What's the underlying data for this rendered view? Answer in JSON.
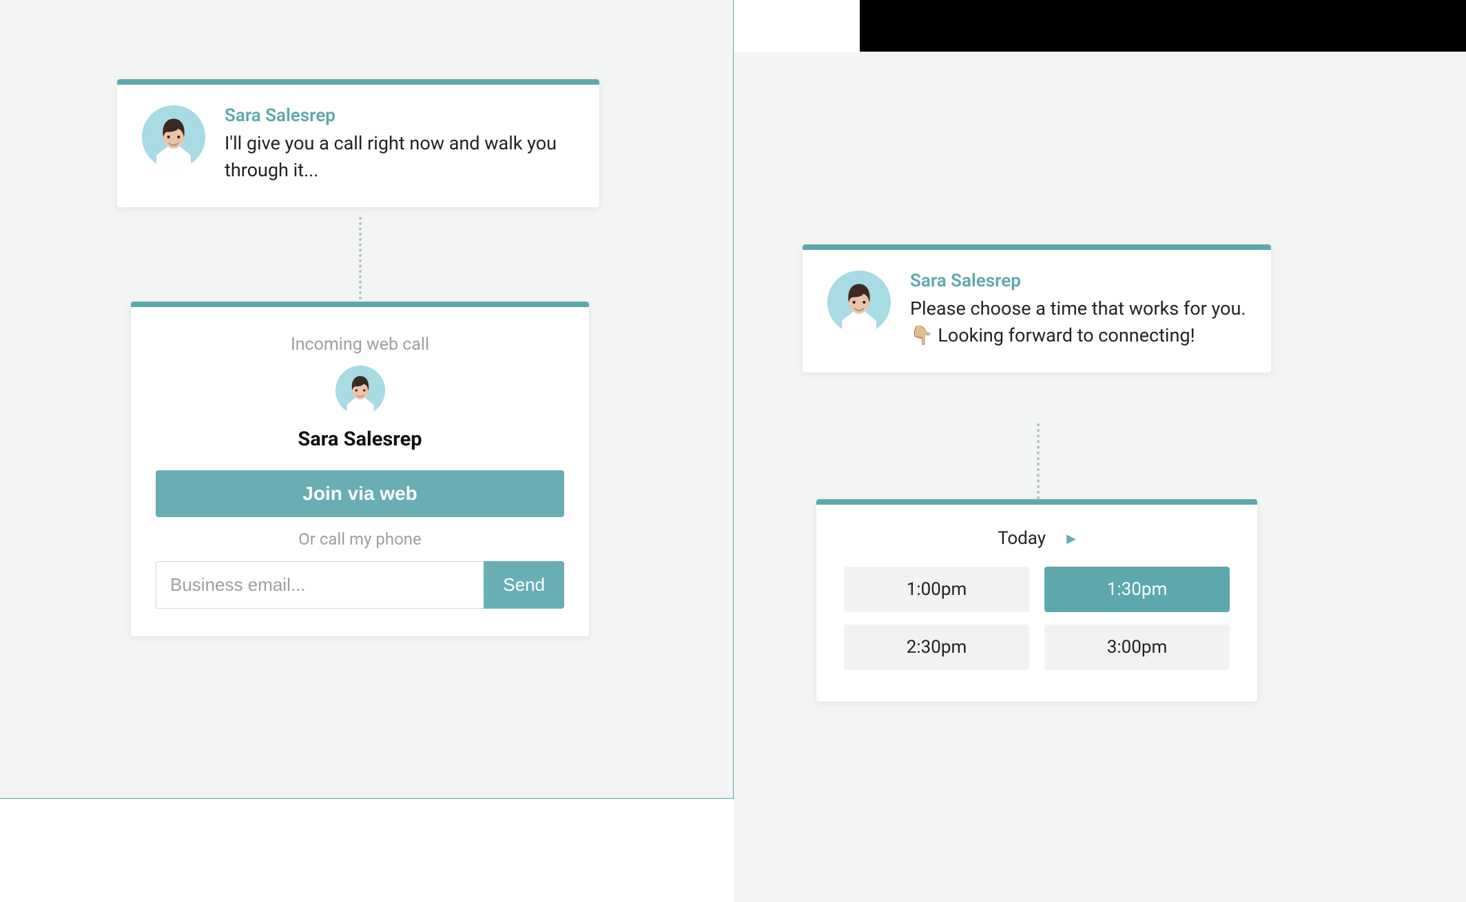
{
  "colors": {
    "accent": "#5da8ad",
    "accent_fill": "#68aeb3",
    "muted": "#9aa0a3",
    "bg_panel": "#f3f5f5"
  },
  "left_panel": {
    "chat": {
      "name": "Sara Salesrep",
      "message": "I'll give you a call right now and walk you through it..."
    },
    "call_card": {
      "label": "Incoming web call",
      "name": "Sara Salesrep",
      "join_button": "Join via web",
      "or_text": "Or call my phone",
      "email_placeholder": "Business email...",
      "send_button": "Send"
    }
  },
  "right_panel": {
    "chat": {
      "name": "Sara Salesrep",
      "message": "Please choose a time that works for you. 👇🏼  Looking forward to connecting!"
    },
    "scheduler": {
      "day_label": "Today",
      "arrow_icon": "chevron-right",
      "slots": [
        {
          "label": "1:00pm",
          "selected": false
        },
        {
          "label": "1:30pm",
          "selected": true
        },
        {
          "label": "2:30pm",
          "selected": false
        },
        {
          "label": "3:00pm",
          "selected": false
        }
      ]
    }
  }
}
